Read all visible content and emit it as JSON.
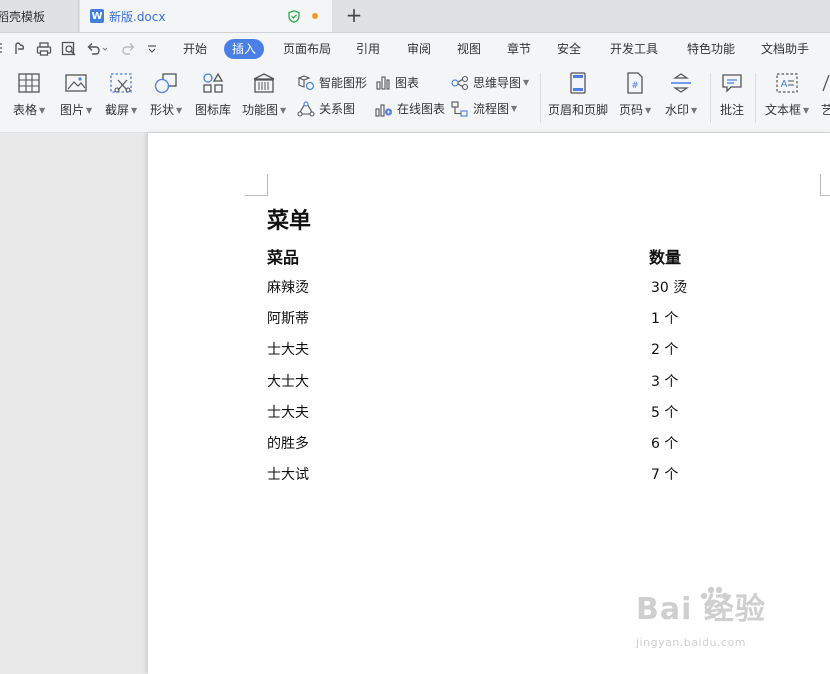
{
  "tabs": {
    "templates_label": "稻壳模板",
    "doc_label": "新版.docx",
    "doc_icon_letter": "W",
    "new_tab": "+"
  },
  "menu": {
    "items": [
      "开始",
      "插入",
      "页面布局",
      "引用",
      "审阅",
      "视图",
      "章节",
      "安全",
      "开发工具",
      "特色功能",
      "文档助手"
    ],
    "active": "插入"
  },
  "ribbon": {
    "table": "表格",
    "picture": "图片",
    "screenshot": "截屏",
    "shape": "形状",
    "icon_lib": "图标库",
    "func_chart": "功能图",
    "smart_shape": "智能图形",
    "chart": "图表",
    "mind_map": "思维导图",
    "relation": "关系图",
    "online_chart": "在线图表",
    "flow_chart": "流程图",
    "header_footer": "页眉和页脚",
    "page_number": "页码",
    "watermark": "水印",
    "comment": "批注",
    "text_box": "文本框",
    "art_text": "艺"
  },
  "document": {
    "title": "菜单",
    "headers": [
      "菜品",
      "数量"
    ],
    "rows": [
      [
        "麻辣烫",
        "30 烫"
      ],
      [
        "阿斯蒂",
        "1 个"
      ],
      [
        "士大夫",
        "2 个"
      ],
      [
        "大士大",
        "3 个"
      ],
      [
        "士大夫",
        "5 个"
      ],
      [
        "的胜多",
        "6 个"
      ],
      [
        "士大试",
        "7 个"
      ]
    ]
  },
  "watermark": {
    "brand": "Bai  经验",
    "url": "jingyan.baidu.com"
  },
  "colors": {
    "accent": "#4a7fe5",
    "tab_title": "#3a6fd8",
    "unsaved_dot": "#f39a2b",
    "shield": "#2ea84a"
  }
}
